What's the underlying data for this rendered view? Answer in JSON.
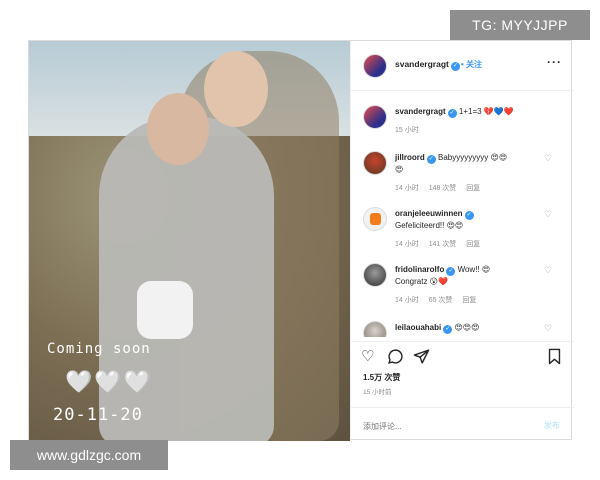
{
  "watermarks": {
    "top": "TG: MYYJJPP",
    "bottom": "www.gdlzgc.com"
  },
  "photo": {
    "caption_line1": "Coming soon",
    "hearts": "🤍🤍🤍",
    "date": "20-11-20"
  },
  "header": {
    "username": "svandergragt",
    "verified": "✓",
    "separator": "•",
    "follow_label": "关注",
    "more_icon": "more-dots-icon",
    "more_glyph": "···"
  },
  "comments": [
    {
      "username": "svandergragt",
      "text": "1+1=3 💔💙❤️",
      "time": "15 小时"
    },
    {
      "username": "jillroord",
      "text": "Babyyyyyyyyy 😍😍",
      "line2": "😍",
      "time": "14 小时",
      "likes": "148 次赞",
      "reply": "回复"
    },
    {
      "username": "oranjeleeuwinnen",
      "line2": "Gefeliciteerd!! 😍😍",
      "time": "14 小时",
      "likes": "141 次赞",
      "reply": "回复"
    },
    {
      "username": "fridolinarolfo",
      "text": "Wow!! 😍",
      "line2": "Congratz 😮❤️",
      "time": "14 小时",
      "likes": "65 次赞",
      "reply": "回复"
    },
    {
      "username": "leilaouahabi",
      "text": "😍😍😍"
    }
  ],
  "actions": {
    "like_icon": "heart-icon",
    "comment_icon": "comment-icon",
    "share_icon": "share-icon",
    "save_icon": "bookmark-icon"
  },
  "likes": "1.5万 次赞",
  "time": "15 小时前",
  "add_comment": {
    "placeholder": "添加评论...",
    "post_label": "发布"
  },
  "colors": {
    "link": "#3897f0",
    "muted": "#8e8e8e",
    "border": "#dbdbdb"
  }
}
